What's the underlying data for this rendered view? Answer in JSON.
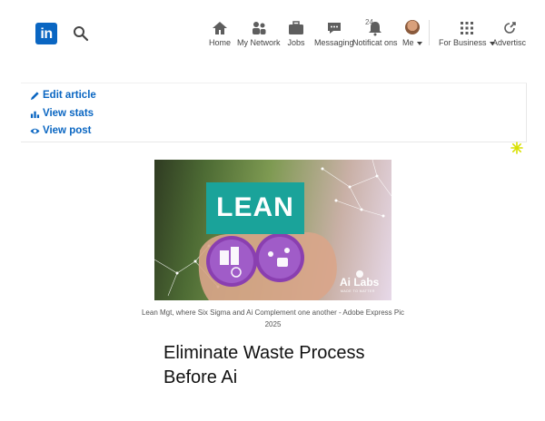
{
  "nav": {
    "logo_text": "in",
    "items": [
      {
        "label": "Home",
        "icon": "home-icon"
      },
      {
        "label": "My Network",
        "icon": "people-icon"
      },
      {
        "label": "Jobs",
        "icon": "briefcase-icon"
      },
      {
        "label": "Messaging",
        "icon": "chat-icon"
      },
      {
        "label": "Notificat ons",
        "icon": "bell-icon",
        "badge": "24"
      },
      {
        "label": "Me",
        "icon": "avatar"
      },
      {
        "label": "For Business",
        "icon": "grid-icon"
      },
      {
        "label": "Advertisc",
        "icon": "advertise-icon"
      }
    ],
    "accent": "#0a66c2"
  },
  "actions": {
    "edit": "Edit article",
    "stats": "View stats",
    "post": "View post"
  },
  "hero": {
    "lean_text": "LEAN",
    "ai_labs": "Ai Labs",
    "ai_labs_sub": "MADE TO MATTER"
  },
  "caption": "Lean Mgt, where Six Sigma and Ai Complement one another - Adobe Express Pic 2025",
  "article": {
    "title": "Eliminate Waste Process Before Ai"
  }
}
